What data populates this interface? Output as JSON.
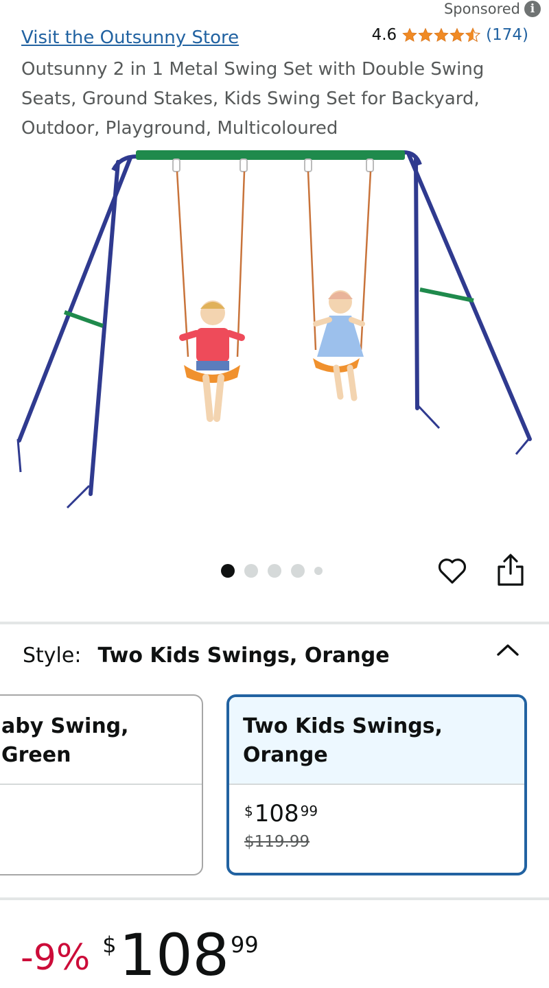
{
  "header": {
    "sponsored_label": "Sponsored",
    "info_icon": "i"
  },
  "product": {
    "store_link": "Visit the Outsunny Store",
    "rating": "4.6",
    "stars": 4.6,
    "review_count": "(174)",
    "title": "Outsunny 2 in 1 Metal Swing Set with Double Swing Seats, Ground Stakes, Kids Swing Set for Backyard, Outdoor, Playground, Multicoloured"
  },
  "gallery": {
    "image_count": 5,
    "active_index": 0
  },
  "style": {
    "label": "Style:",
    "selected": "Two Kids Swings, Orange",
    "options": [
      {
        "name": "aby Swing, Green",
        "price_symbol": "",
        "price_whole": "",
        "price_cents": "",
        "list_price": ""
      },
      {
        "name": "Two Kids Swings, Orange",
        "price_symbol": "$",
        "price_whole": "108",
        "price_cents": "99",
        "list_price": "$119.99"
      }
    ]
  },
  "price": {
    "discount": "-9%",
    "symbol": "$",
    "whole": "108",
    "cents": "99"
  },
  "colors": {
    "link": "#2162a1",
    "star": "#f08a24",
    "discount": "#cc0c39",
    "selected_border": "#2162a1",
    "selected_bg": "#edf8ff",
    "frame_blue": "#2f3a8f",
    "top_bar_green": "#1f8a4c",
    "seat_orange": "#f0912e"
  }
}
